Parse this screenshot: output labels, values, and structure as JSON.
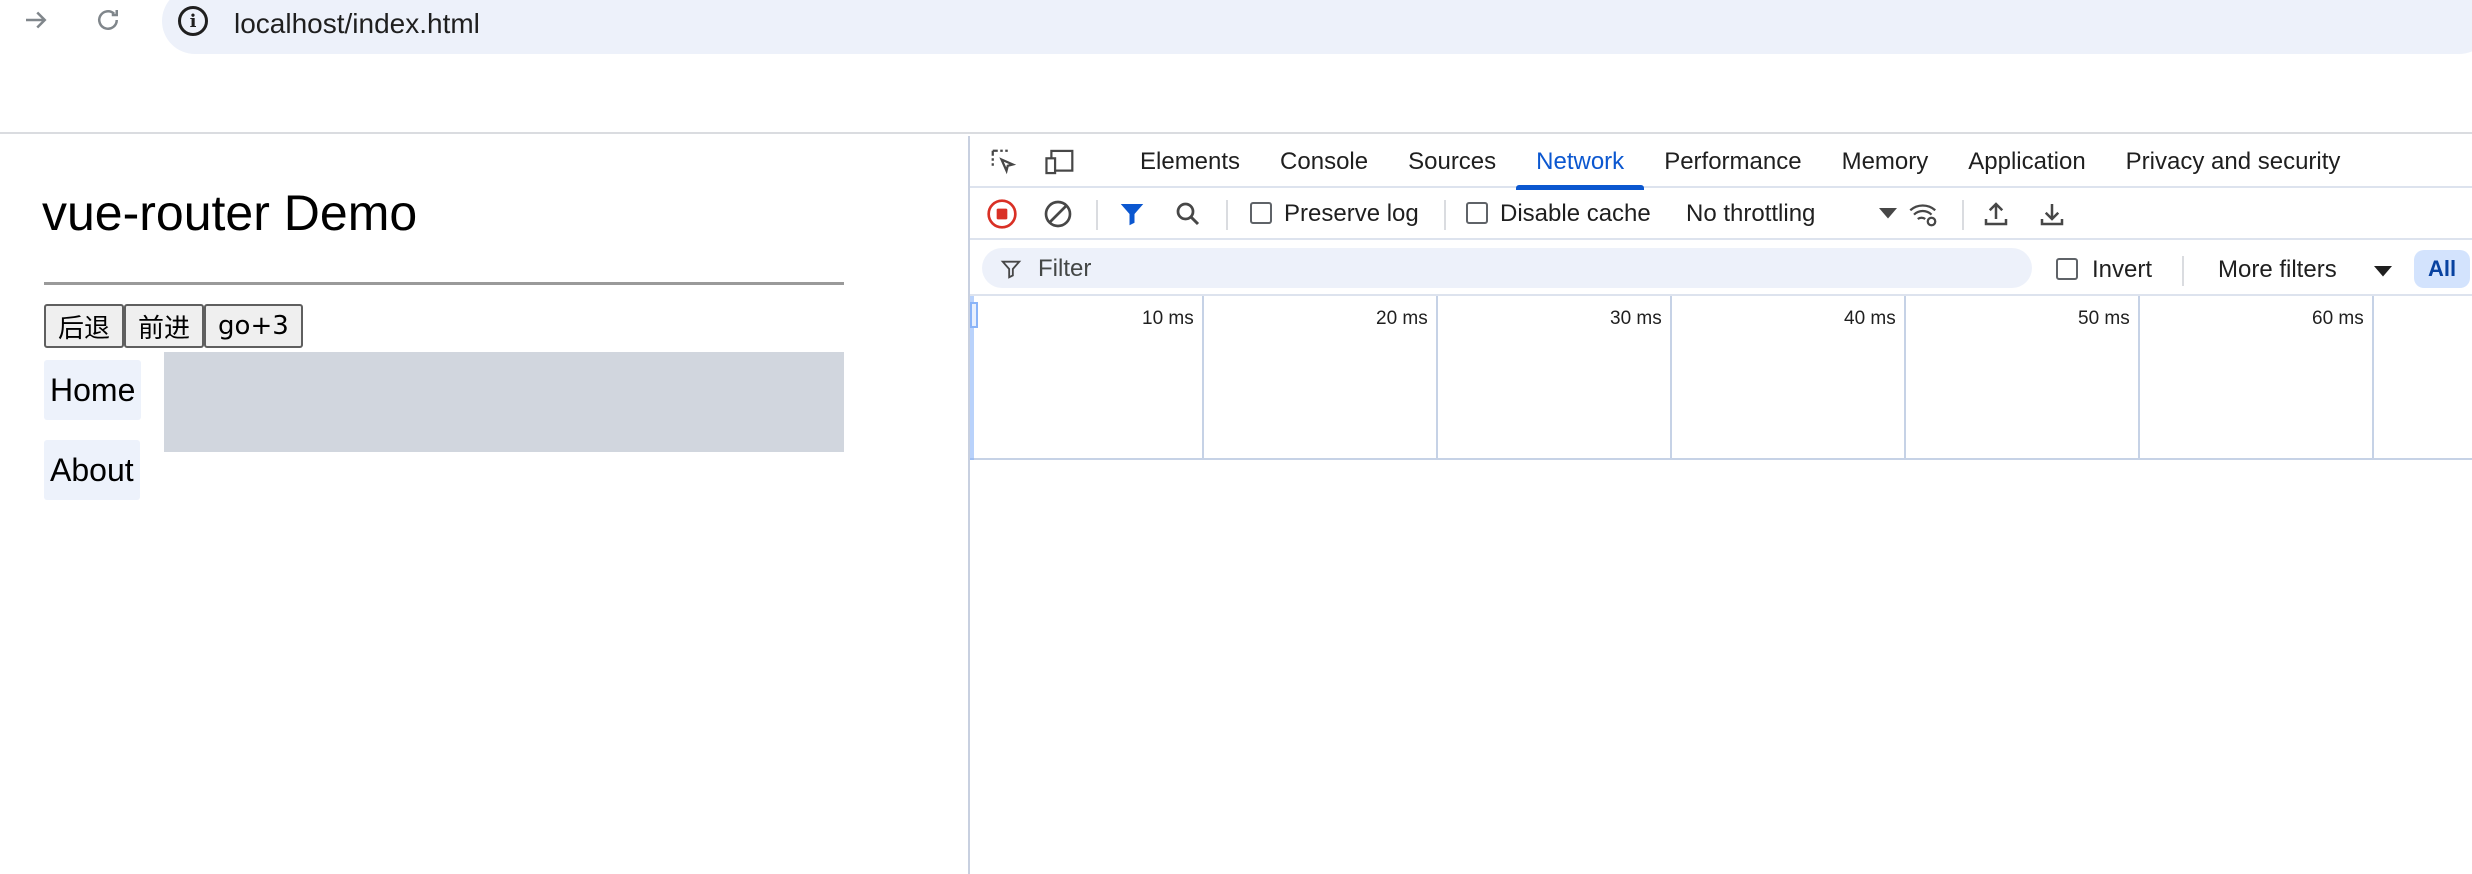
{
  "browser": {
    "url": "localhost/index.html",
    "forward_icon": "arrow-right-icon",
    "reload_icon": "reload-icon",
    "info_icon": "info-icon"
  },
  "page": {
    "title": "vue-router Demo",
    "buttons": [
      "后退",
      "前进",
      "go+3"
    ],
    "links": [
      "Home",
      "About"
    ]
  },
  "devtools": {
    "tabs": [
      "Elements",
      "Console",
      "Sources",
      "Network",
      "Performance",
      "Memory",
      "Application",
      "Privacy and security"
    ],
    "active_tab": "Network",
    "toolbar": {
      "preserve_log": "Preserve log",
      "disable_cache": "Disable cache",
      "throttling": "No throttling"
    },
    "filter": {
      "placeholder": "Filter",
      "invert": "Invert",
      "more_filters": "More filters",
      "all": "All"
    },
    "timeline_ticks": [
      "10 ms",
      "20 ms",
      "30 ms",
      "40 ms",
      "50 ms",
      "60 ms"
    ],
    "colors": {
      "accent": "#0b57d0",
      "record": "#d93025",
      "filter_active": "#0b57d0"
    }
  }
}
